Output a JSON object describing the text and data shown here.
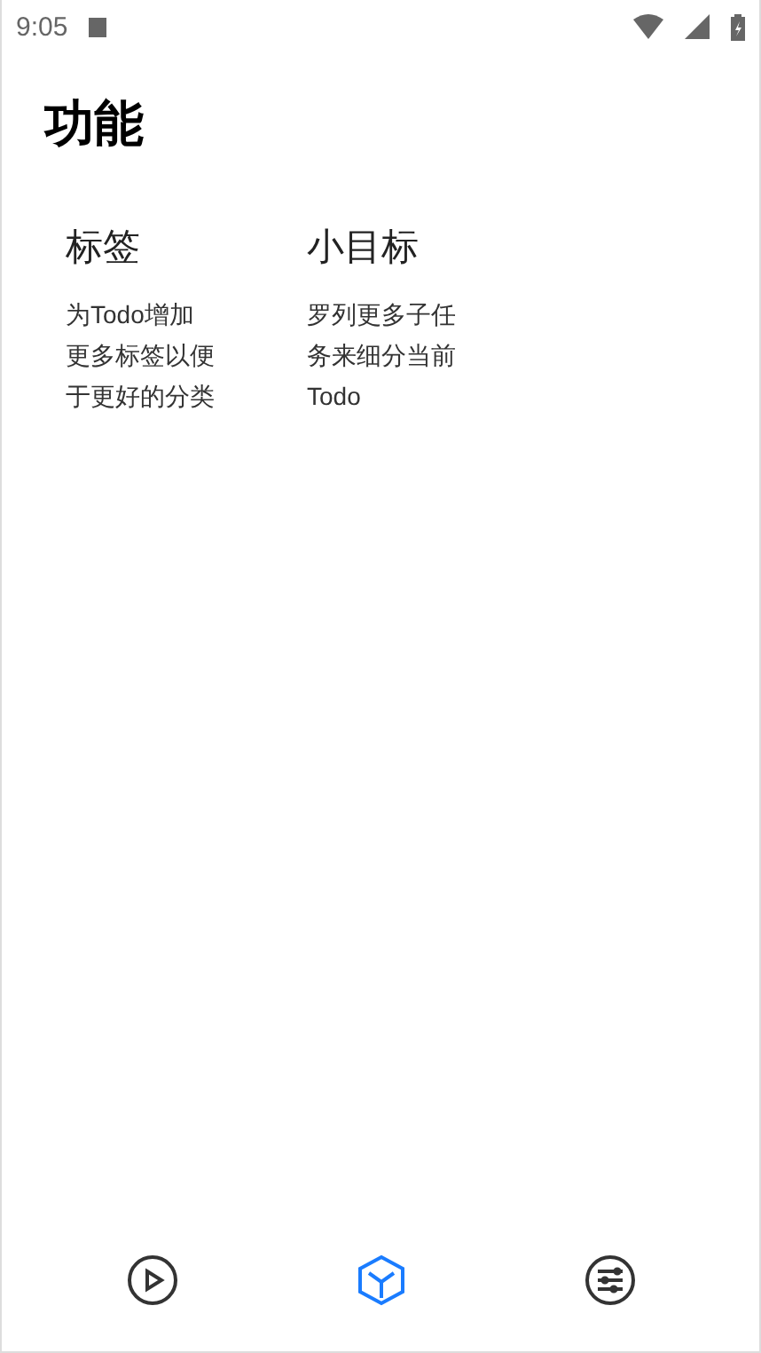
{
  "status_bar": {
    "time": "9:05"
  },
  "title": "功能",
  "features": [
    {
      "title": "标签",
      "description": "为Todo增加更多标签以便于更好的分类"
    },
    {
      "title": "小目标",
      "description": "罗列更多子任务来细分当前Todo"
    }
  ],
  "bottom_nav": [
    {
      "kind": "play",
      "selected": false
    },
    {
      "kind": "cube",
      "selected": true
    },
    {
      "kind": "sliders",
      "selected": false
    }
  ]
}
